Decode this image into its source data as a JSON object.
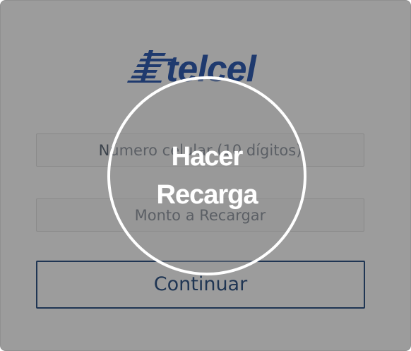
{
  "brand": {
    "logo_text": "telcel",
    "logo_color": "#1f3a6e"
  },
  "form": {
    "phone_placeholder": "Número celular (10 dígitos)",
    "amount_placeholder": "Monto a Recargar",
    "continue_label": "Continuar"
  },
  "overlay": {
    "action_label": "Hacer\nRecarga"
  },
  "colors": {
    "overlay_gray": "#9c9c9c",
    "button_border": "#1f3553",
    "circle": "#ffffff"
  }
}
